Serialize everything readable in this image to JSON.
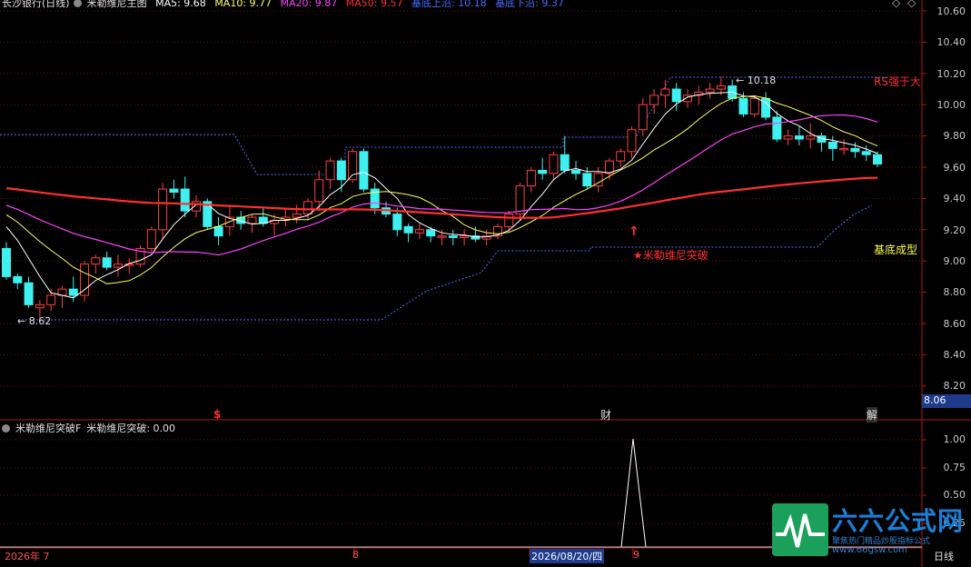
{
  "header": {
    "stock": "长沙银行(日线)",
    "indicator": "米勒维尼主图",
    "ma5": "MA5: 9.68",
    "ma10": "MA10: 9.77",
    "ma20": "MA20: 9.87",
    "ma50": "MA50: 9.57",
    "base_top": "基底上沿: 10.18",
    "base_bottom": "基底下沿: 9.37"
  },
  "colors": {
    "ma5": "#ffffff",
    "ma10": "#ffff60",
    "ma20": "#ff40ff",
    "ma50": "#ff3030",
    "base": "#4a6bff",
    "up": "#ff4040",
    "down": "#3ff0f0",
    "axis": "#b01818"
  },
  "price_axis": [
    "10.60",
    "10.40",
    "10.20",
    "10.00",
    "9.80",
    "9.60",
    "9.40",
    "9.20",
    "9.00",
    "8.80",
    "8.60",
    "8.40",
    "8.20"
  ],
  "current_price": "8.06",
  "annotations": {
    "high": "10.18",
    "low": "8.62",
    "rs": "RS强于大",
    "breakout": "★米勒维尼突破",
    "base_formed": "基底成型"
  },
  "event_markers": {
    "s": "$",
    "cai": "财",
    "jie": "解"
  },
  "sub": {
    "name": "米勒维尼突破F",
    "value_label": "米勒维尼突破: 0.00",
    "axis": [
      "1.00",
      "0.75",
      "0.50",
      "0.25"
    ],
    "period": "日线"
  },
  "dates": {
    "year": "2026年 7",
    "m8": "8",
    "cursor": "2026/08/20/四",
    "m9": "9"
  },
  "logo": {
    "title": "六六公式网",
    "slogan": "聚焦热门精品炒股指标公式",
    "url": "www.66gsw.com"
  }
}
